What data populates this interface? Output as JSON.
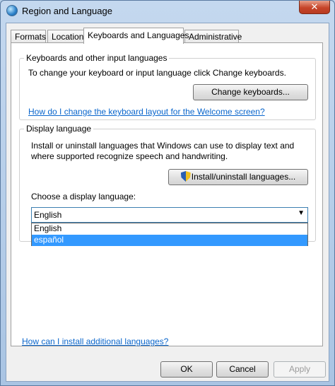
{
  "window": {
    "title": "Region and Language",
    "close_label": "✕"
  },
  "tabs": [
    {
      "label": "Formats"
    },
    {
      "label": "Location"
    },
    {
      "label": "Keyboards and Languages"
    },
    {
      "label": "Administrative"
    }
  ],
  "keyboards_group": {
    "legend": "Keyboards and other input languages",
    "description": "To change your keyboard or input language click Change keyboards.",
    "change_button": "Change keyboards...",
    "help_link": "How do I change the keyboard layout for the Welcome screen?"
  },
  "display_group": {
    "legend": "Display language",
    "description_line1": "Install or uninstall languages that Windows can use to display text and",
    "description_line2": "where supported recognize speech and handwriting.",
    "install_button": "Install/uninstall languages...",
    "choose_label": "Choose a display language:",
    "selected_value": "English",
    "options": [
      {
        "label": "English"
      },
      {
        "label": "español"
      }
    ]
  },
  "additional_link": "How can I install additional languages?",
  "footer": {
    "ok": "OK",
    "cancel": "Cancel",
    "apply": "Apply"
  },
  "icons": {
    "window": "globe-icon",
    "install": "uac-shield-icon"
  }
}
